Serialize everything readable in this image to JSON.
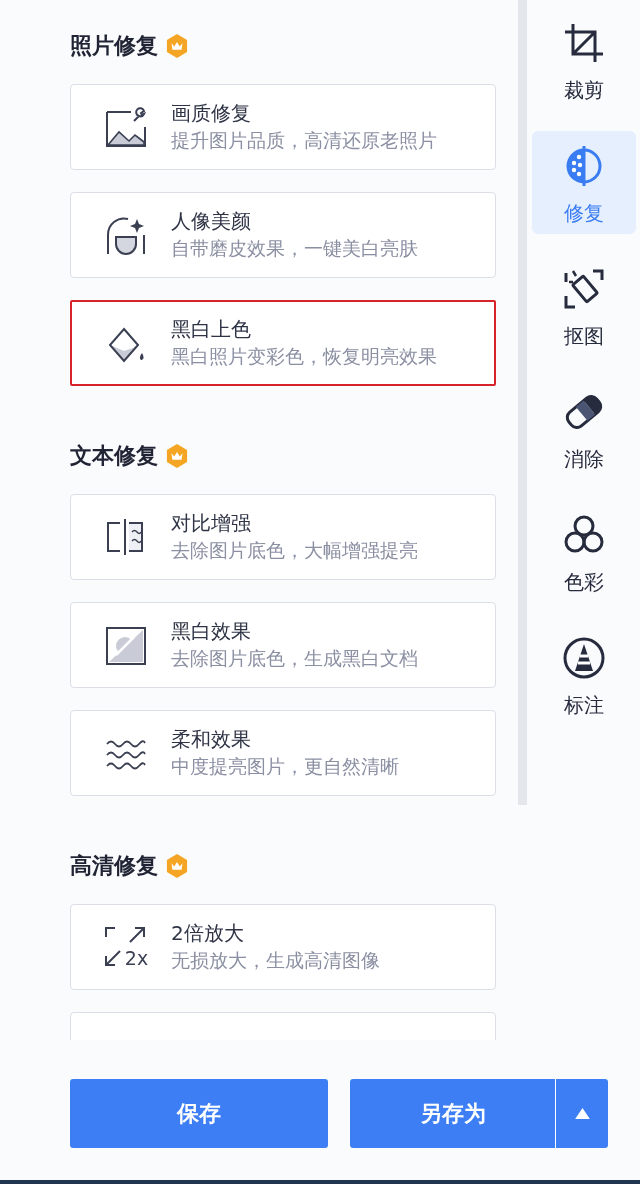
{
  "sections": [
    {
      "title": "照片修复",
      "premium": true,
      "items": [
        {
          "kind": "picture_repair",
          "title": "画质修复",
          "subtitle": "提升图片品质，高清还原老照片",
          "highlighted": false
        },
        {
          "kind": "portrait",
          "title": "人像美颜",
          "subtitle": "自带磨皮效果，一键美白亮肤",
          "highlighted": false
        },
        {
          "kind": "colorize",
          "title": "黑白上色",
          "subtitle": "黑白照片变彩色，恢复明亮效果",
          "highlighted": true
        }
      ]
    },
    {
      "title": "文本修复",
      "premium": true,
      "items": [
        {
          "kind": "contrast",
          "title": "对比增强",
          "subtitle": "去除图片底色，大幅增强提亮",
          "highlighted": false
        },
        {
          "kind": "black_white",
          "title": "黑白效果",
          "subtitle": "去除图片底色，生成黑白文档",
          "highlighted": false
        },
        {
          "kind": "soft",
          "title": "柔和效果",
          "subtitle": "中度提亮图片，更自然清晰",
          "highlighted": false
        }
      ]
    },
    {
      "title": "高清修复",
      "premium": true,
      "items": [
        {
          "kind": "upscale",
          "icon_label": "2x",
          "title": "2倍放大",
          "subtitle": "无损放大，生成高清图像",
          "highlighted": false
        },
        {
          "kind": "cut_off"
        }
      ]
    }
  ],
  "sidebar": {
    "items": [
      {
        "kind": "crop",
        "label": "裁剪",
        "selected": false
      },
      {
        "kind": "repair",
        "label": "修复",
        "selected": true
      },
      {
        "kind": "cutout",
        "label": "抠图",
        "selected": false
      },
      {
        "kind": "erase",
        "label": "消除",
        "selected": false
      },
      {
        "kind": "color",
        "label": "色彩",
        "selected": false
      },
      {
        "kind": "annotate",
        "label": "标注",
        "selected": false
      }
    ]
  },
  "buttons": {
    "save": "保存",
    "save_as": "另存为"
  }
}
